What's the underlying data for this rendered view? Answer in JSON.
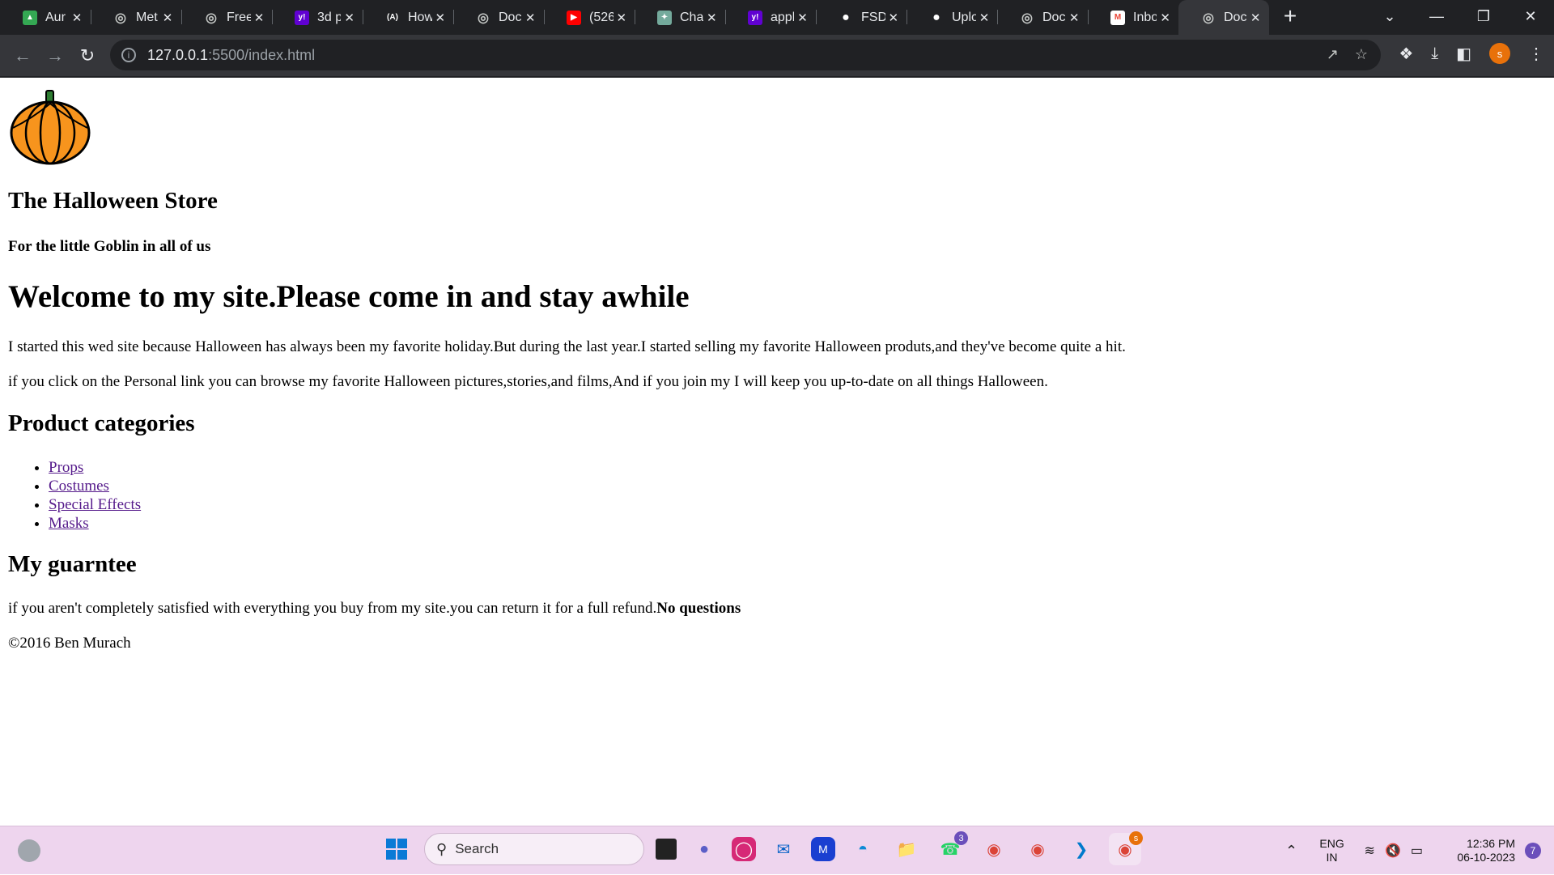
{
  "browser": {
    "tabs": [
      {
        "title": "Aur",
        "icon": "app-icon",
        "color": "#34a853",
        "glyph": "▲"
      },
      {
        "title": "Met",
        "icon": "globe-icon",
        "color": "#5f6368",
        "glyph": "◎"
      },
      {
        "title": "Free",
        "icon": "globe-icon",
        "color": "#5f6368",
        "glyph": "◎"
      },
      {
        "title": "3d p",
        "icon": "yahoo-icon",
        "color": "#6001d2",
        "glyph": "y!"
      },
      {
        "title": "How",
        "icon": "app-icon",
        "color": "#202124",
        "glyph": "(A)"
      },
      {
        "title": "Doc",
        "icon": "globe-icon",
        "color": "#5f6368",
        "glyph": "◎"
      },
      {
        "title": "(526",
        "icon": "youtube-icon",
        "color": "#ff0000",
        "glyph": "▶"
      },
      {
        "title": "Cha",
        "icon": "chatgpt-icon",
        "color": "#74aa9c",
        "glyph": "✦"
      },
      {
        "title": "appl",
        "icon": "yahoo-icon",
        "color": "#6001d2",
        "glyph": "y!"
      },
      {
        "title": "FSD",
        "icon": "github-icon",
        "color": "#202124",
        "glyph": "●"
      },
      {
        "title": "Uplo",
        "icon": "github-icon",
        "color": "#202124",
        "glyph": "●"
      },
      {
        "title": "Doc",
        "icon": "globe-icon",
        "color": "#5f6368",
        "glyph": "◎"
      },
      {
        "title": "Inbo",
        "icon": "gmail-icon",
        "color": "#ffffff",
        "glyph": "M"
      },
      {
        "title": "Doc",
        "icon": "globe-icon",
        "color": "#5f6368",
        "glyph": "◎",
        "active": true
      }
    ],
    "url_host": "127.0.0.1",
    "url_rest": ":5500/index.html",
    "profile_initial": "s"
  },
  "page": {
    "store_title": "The Halloween Store",
    "tagline": "For the little Goblin in all of us",
    "welcome_heading": "Welcome to my site.Please come in and stay awhile",
    "para1": "I started this wed site because Halloween has always been my favorite holiday.But during the last year.I started selling my favorite Halloween produts,and they've become quite a hit.",
    "para2": "if you click on the Personal link you can browse my favorite Halloween pictures,stories,and films,And if you join my I will keep you up-to-date on all things Halloween.",
    "categories_heading": "Product categories",
    "categories": [
      "Props",
      "Costumes",
      "Special Effects",
      "Masks"
    ],
    "guarantee_heading": "My guarntee",
    "guarantee_text": "if you aren't completely satisfied with everything you buy from my site.you can return it for a full refund.",
    "guarantee_bold": "No questions",
    "copyright": "©2016 Ben Murach"
  },
  "taskbar": {
    "search_placeholder": "Search",
    "whatsapp_badge": "3",
    "chrome_badge": "s",
    "lang_line1": "ENG",
    "lang_line2": "IN",
    "time": "12:36 PM",
    "date": "06-10-2023",
    "notification_count": "7"
  }
}
